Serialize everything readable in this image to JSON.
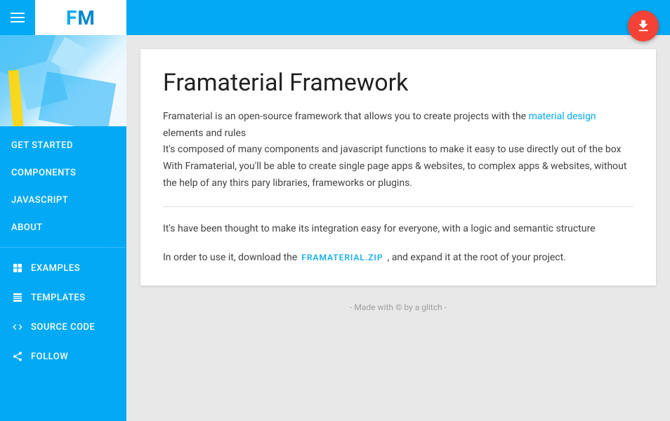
{
  "header": {
    "menu_label": "Menu",
    "logo": "FM",
    "download_label": "Download"
  },
  "sidebar": {
    "nav_items": [
      {
        "id": "get-started",
        "label": "GET STARTED",
        "icon": null
      },
      {
        "id": "components",
        "label": "COMPONENTS",
        "icon": null
      },
      {
        "id": "javascript",
        "label": "JAVASCRIPT",
        "icon": null
      },
      {
        "id": "about",
        "label": "ABOUT",
        "icon": null
      }
    ],
    "external_items": [
      {
        "id": "examples",
        "label": "EXAMPLES",
        "icon": "grid"
      },
      {
        "id": "templates",
        "label": "TEMPLATES",
        "icon": "lines"
      },
      {
        "id": "source-code",
        "label": "SOURCE CODE",
        "icon": "code"
      },
      {
        "id": "follow",
        "label": "FOLLOW",
        "icon": "share"
      }
    ]
  },
  "content": {
    "title": "Framaterial Framework",
    "paragraph1": "Framaterial is an open-source framework that allows you to create projects with the ",
    "link_text": "material design",
    "paragraph1_end": " elements and rules",
    "paragraph2": "It's composed of many components and javascript functions to make it easy to use directly out of the box",
    "paragraph3": "With Framaterial, you'll be able to create single page apps & websites, to complex apps & websites, without the help of any thirs pary libraries, frameworks or plugins.",
    "integration_text": "It's have been thought to make its integration easy for everyone, with a logic and semantic structure",
    "download_prefix": "In order to use it, download the",
    "download_link": "FRAMATERIAL.ZIP",
    "download_suffix": ", and expand it at the root of your project.",
    "footer": "- Made with © by a glitch -"
  }
}
